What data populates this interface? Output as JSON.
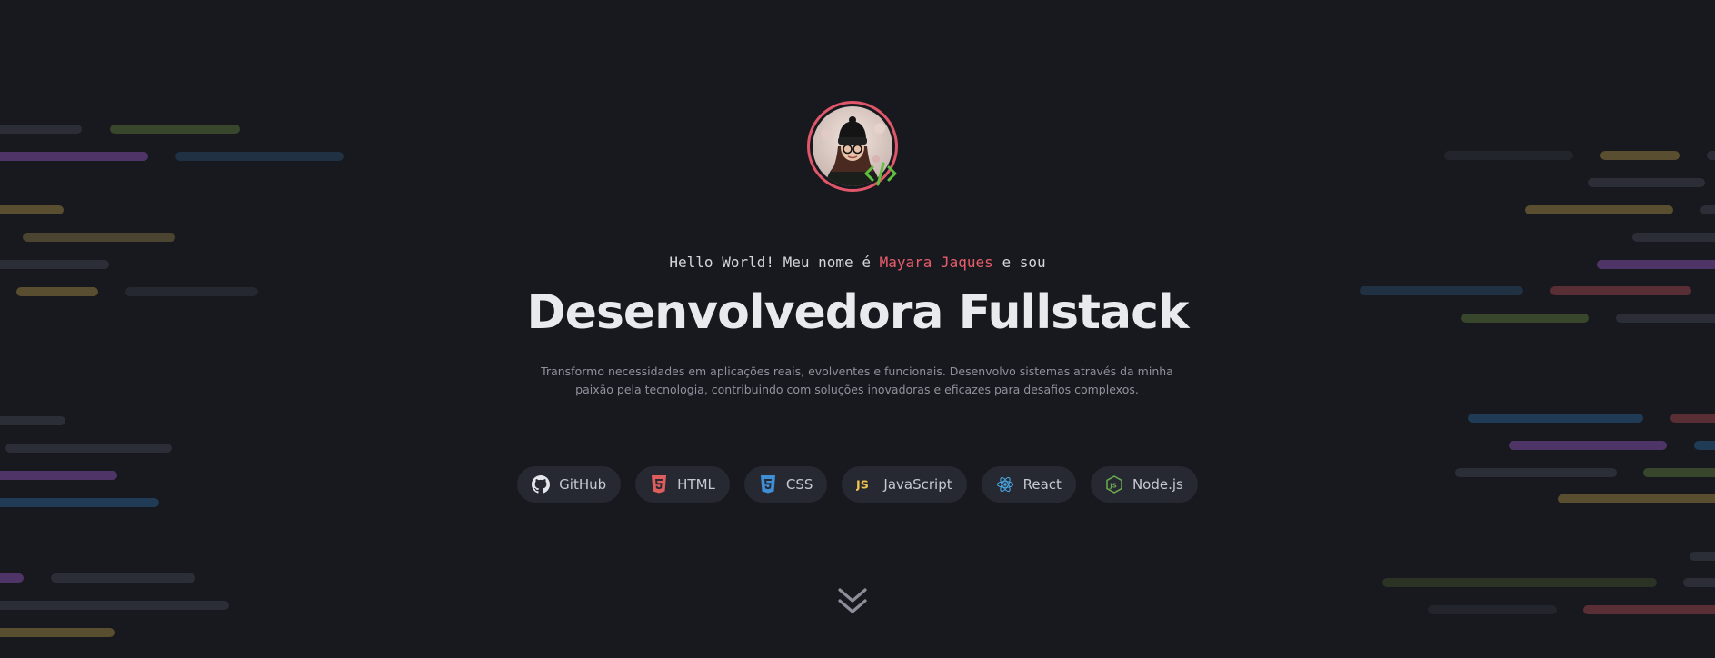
{
  "hero": {
    "greeting_prefix": "Hello World! Meu nome é ",
    "greeting_name": "Mayara Jaques",
    "greeting_suffix": " e sou",
    "title": "Desenvolvedora Fullstack",
    "description": "Transformo necessidades em aplicações reais, evolventes e funcionais. Desenvolvo sistemas através da minha paixão pela tecnologia, contribuindo com soluções inovadoras e eficazes para desafios complexos."
  },
  "skills": [
    {
      "label": "GitHub",
      "icon": "github-icon"
    },
    {
      "label": "HTML",
      "icon": "html5-icon"
    },
    {
      "label": "CSS",
      "icon": "css3-icon"
    },
    {
      "label": "JavaScript",
      "icon": "javascript-icon"
    },
    {
      "label": "React",
      "icon": "react-icon"
    },
    {
      "label": "Node.js",
      "icon": "nodejs-icon"
    }
  ],
  "colors": {
    "background": "#18191e",
    "accent": "#e85d6c",
    "chip_background": "#272932",
    "code_green": "#5fbf3f"
  },
  "icons": {
    "avatar_badge": "code-brackets-icon",
    "scroll": "double-chevron-down-icon"
  }
}
